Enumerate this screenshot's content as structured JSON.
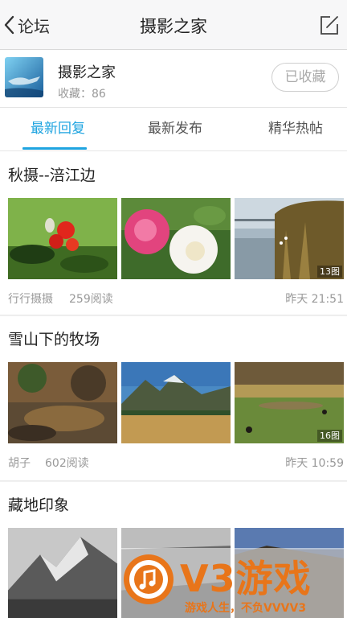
{
  "navbar": {
    "back_label": "论坛",
    "title": "摄影之家"
  },
  "forum": {
    "name": "摄影之家",
    "fav_label": "收藏：",
    "fav_count": "86",
    "fav_button": "已收藏"
  },
  "tabs": [
    {
      "label": "最新回复",
      "active": true
    },
    {
      "label": "最新发布",
      "active": false
    },
    {
      "label": "精华热帖",
      "active": false
    }
  ],
  "posts": [
    {
      "title": "秋摄--涪江边",
      "author": "行行摄摄",
      "reads": "259阅读",
      "time": "昨天 21:51",
      "image_count": "13图"
    },
    {
      "title": "雪山下的牧场",
      "author": "胡子",
      "reads": "602阅读",
      "time": "昨天 10:59",
      "image_count": "16图"
    },
    {
      "title": "藏地印象"
    }
  ],
  "watermark": {
    "brand": "V3游戏",
    "slogan": "游戏人生，不负VVVV3"
  },
  "colors": {
    "accent": "#1fa4e0",
    "watermark": "#e8751a"
  },
  "icons": {
    "back": "chevron-left-icon",
    "compose": "compose-icon"
  }
}
